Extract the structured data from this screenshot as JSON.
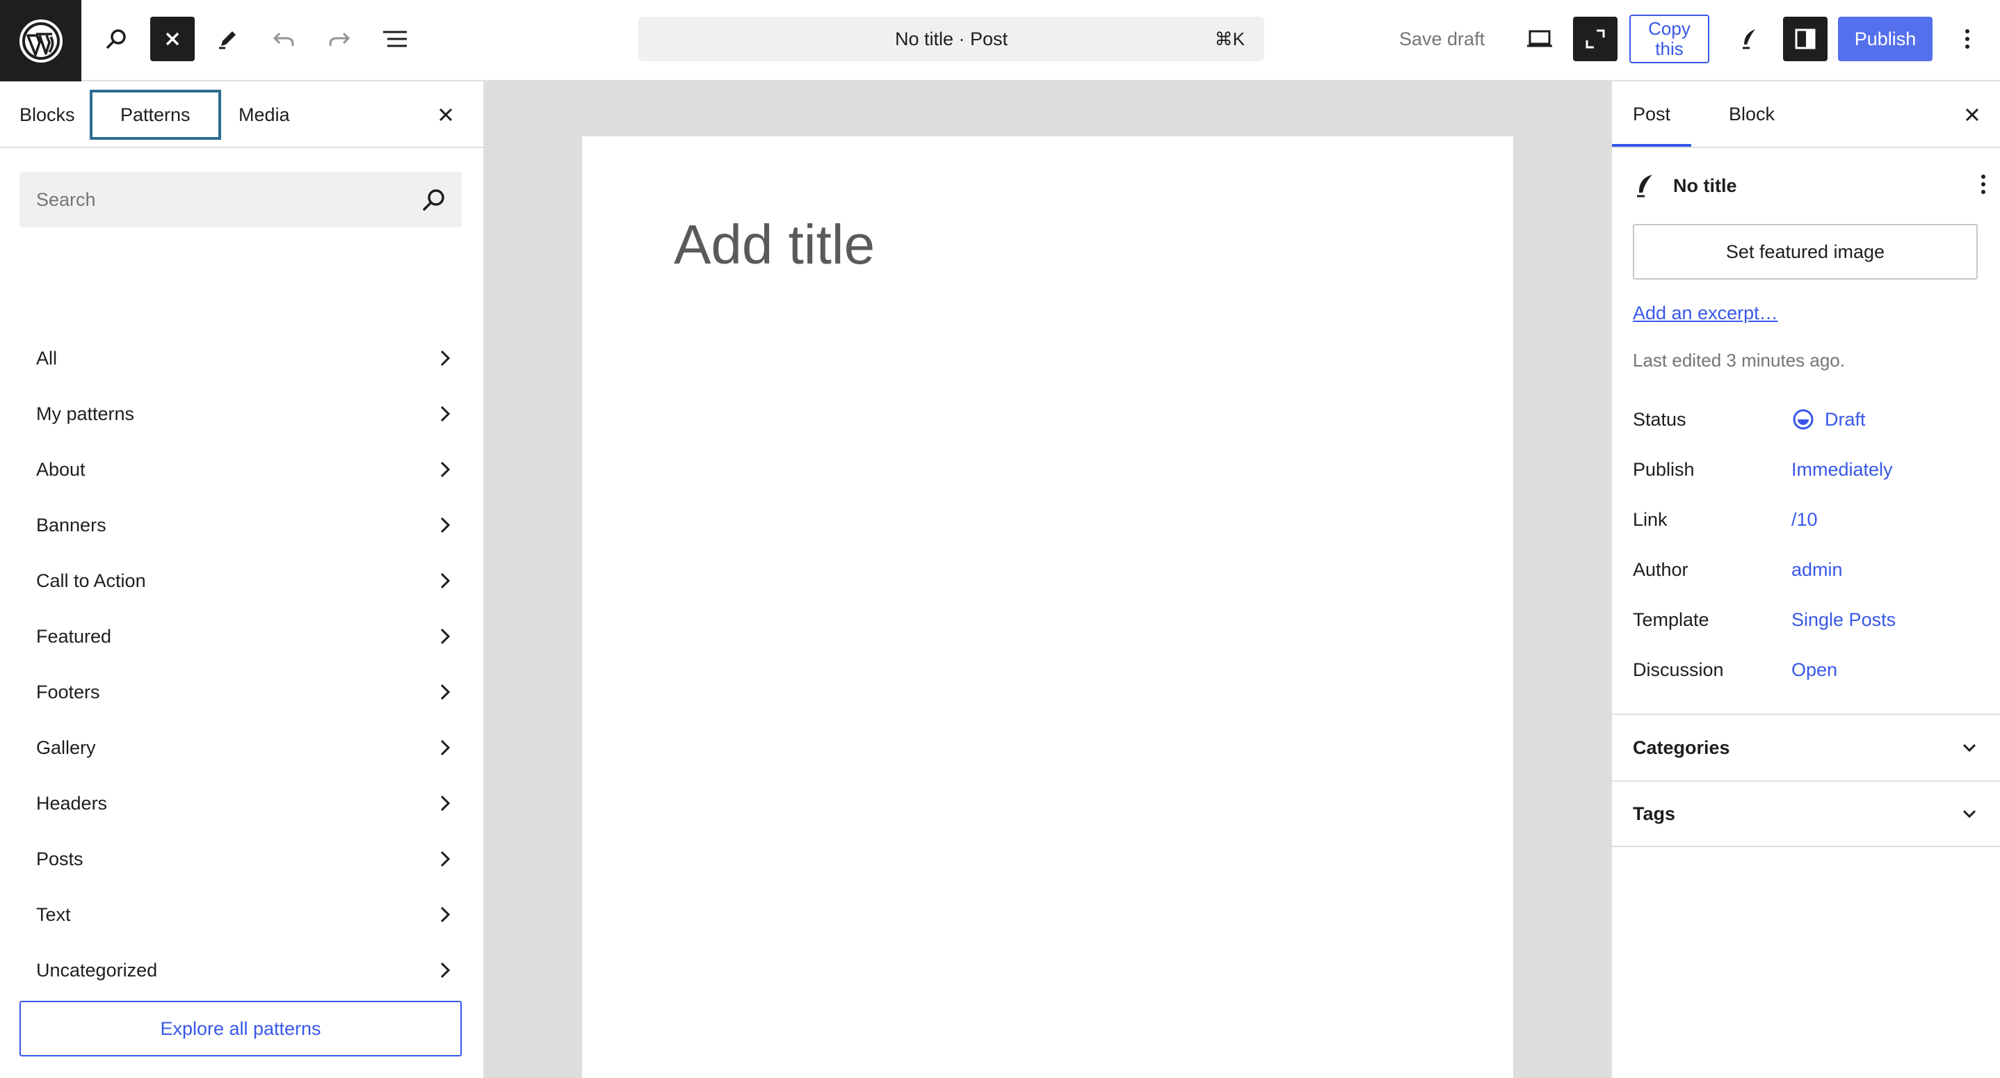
{
  "toolbar": {
    "command_title": "No title · Post",
    "command_shortcut": "⌘K",
    "save_draft_label": "Save draft",
    "copy_line1": "Copy",
    "copy_line2": "this",
    "publish_label": "Publish",
    "icons": [
      "wordpress-logo",
      "search-icon",
      "close-icon",
      "pencil-icon",
      "undo-icon",
      "redo-icon",
      "list-view-icon",
      "desktop-preview-icon",
      "fullscreen-icon",
      "style-icon",
      "sidebar-toggle-icon",
      "more-vertical-icon"
    ]
  },
  "inserter": {
    "tabs": [
      "Blocks",
      "Patterns",
      "Media"
    ],
    "active_tab": "Patterns",
    "search_placeholder": "Search",
    "categories": [
      "All",
      "My patterns",
      "About",
      "Banners",
      "Call to Action",
      "Featured",
      "Footers",
      "Gallery",
      "Headers",
      "Posts",
      "Text",
      "Uncategorized"
    ],
    "explore_label": "Explore all patterns"
  },
  "editor": {
    "title_placeholder": "Add title"
  },
  "sidebar": {
    "tabs": [
      "Post",
      "Block"
    ],
    "active_tab": "Post",
    "post_title": "No title",
    "featured_image_label": "Set featured image",
    "excerpt_link": "Add an excerpt…",
    "last_edited": "Last edited 3 minutes ago.",
    "meta": [
      {
        "label": "Status",
        "value": "Draft"
      },
      {
        "label": "Publish",
        "value": "Immediately"
      },
      {
        "label": "Link",
        "value": "/10"
      },
      {
        "label": "Author",
        "value": "admin"
      },
      {
        "label": "Template",
        "value": "Single Posts"
      },
      {
        "label": "Discussion",
        "value": "Open"
      }
    ],
    "sections": [
      "Categories",
      "Tags"
    ]
  },
  "colors": {
    "accent": "#3858e9",
    "dark": "#1e1e1e",
    "canvas_bg": "#dddddd",
    "focus_outline": "#2e6c91"
  }
}
